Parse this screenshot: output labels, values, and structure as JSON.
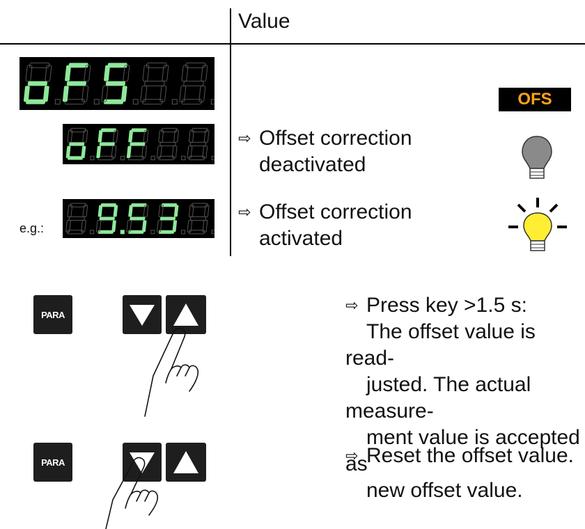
{
  "header": {
    "column_label": "Value"
  },
  "displays": {
    "param_name": [
      "o",
      "F",
      "5",
      "8",
      "8"
    ],
    "off_state": [
      "o",
      "F",
      "F",
      "8",
      "8"
    ],
    "example_value": [
      "8",
      "9",
      "5",
      "3",
      "8"
    ],
    "active_color": "#8fe89a",
    "dim_color": "#2a2a2a"
  },
  "badge": {
    "label": "OFS",
    "color": "#ffa21a"
  },
  "rows": {
    "off": {
      "line1": "Offset correction",
      "line2": "deactivated"
    },
    "on": {
      "prefix": "e.g.:",
      "line1": "Offset correction",
      "line2": "activated"
    }
  },
  "lamps": {
    "off_color": "#8a8a8a",
    "on_color": "#ffee33"
  },
  "arrow_glyph": "⇨",
  "keys": {
    "para_label": "PARA",
    "down_icon": "triangle-down",
    "up_icon": "triangle-up"
  },
  "instructions": {
    "press_up": [
      "Press key >1.5 s:",
      "The offset value is read-",
      "justed. The actual measure-",
      "ment value is accepted as",
      "new offset value."
    ],
    "press_down": "Reset the offset value."
  }
}
